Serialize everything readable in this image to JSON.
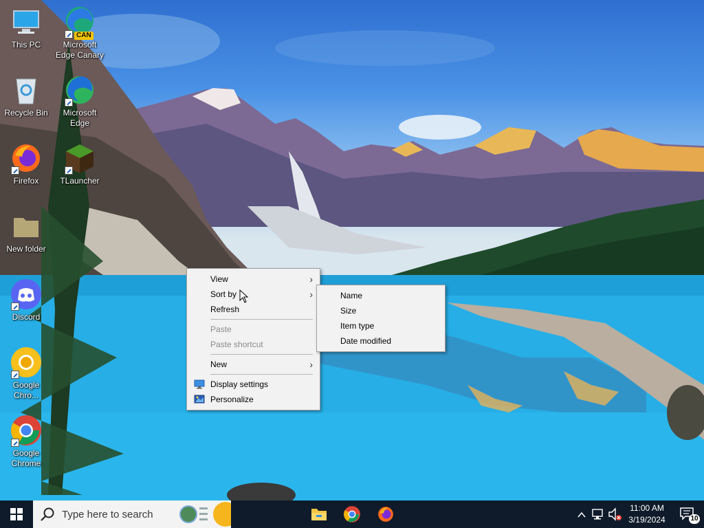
{
  "desktop": {
    "icons": [
      {
        "label": "This PC",
        "icon": "this-pc-icon"
      },
      {
        "label": "Microsoft Edge Canary",
        "badge": "CAN",
        "icon": "edge-canary-icon"
      },
      {
        "label": "Recycle Bin",
        "icon": "recycle-bin-icon"
      },
      {
        "label": "Microsoft Edge",
        "icon": "edge-icon"
      },
      {
        "label": "Firefox",
        "icon": "firefox-icon"
      },
      {
        "label": "TLauncher",
        "icon": "tlauncher-icon"
      },
      {
        "label": "New folder",
        "icon": "folder-icon"
      },
      {
        "label": "Discord",
        "icon": "discord-icon"
      },
      {
        "label": "Google Chro...",
        "icon": "google-chrome-canary-icon"
      },
      {
        "label": "Google Chrome",
        "icon": "google-chrome-icon"
      }
    ]
  },
  "context_menu": {
    "view": "View",
    "sort_by": "Sort by",
    "refresh": "Refresh",
    "paste": "Paste",
    "paste_shortcut": "Paste shortcut",
    "new": "New",
    "display_settings": "Display settings",
    "personalize": "Personalize"
  },
  "sort_submenu": {
    "name": "Name",
    "size": "Size",
    "item_type": "Item type",
    "date_modified": "Date modified"
  },
  "taskbar": {
    "search_placeholder": "Type here to search",
    "pinned": [
      "file-explorer-icon",
      "google-chrome-icon",
      "firefox-icon"
    ],
    "clock_time": "11:00 AM",
    "clock_date": "3/19/2024",
    "notification_count": "10"
  },
  "colors": {
    "taskbar": "#0f1b2a",
    "menu_bg": "#f2f2f2",
    "menu_disabled": "#8a8a8a"
  }
}
